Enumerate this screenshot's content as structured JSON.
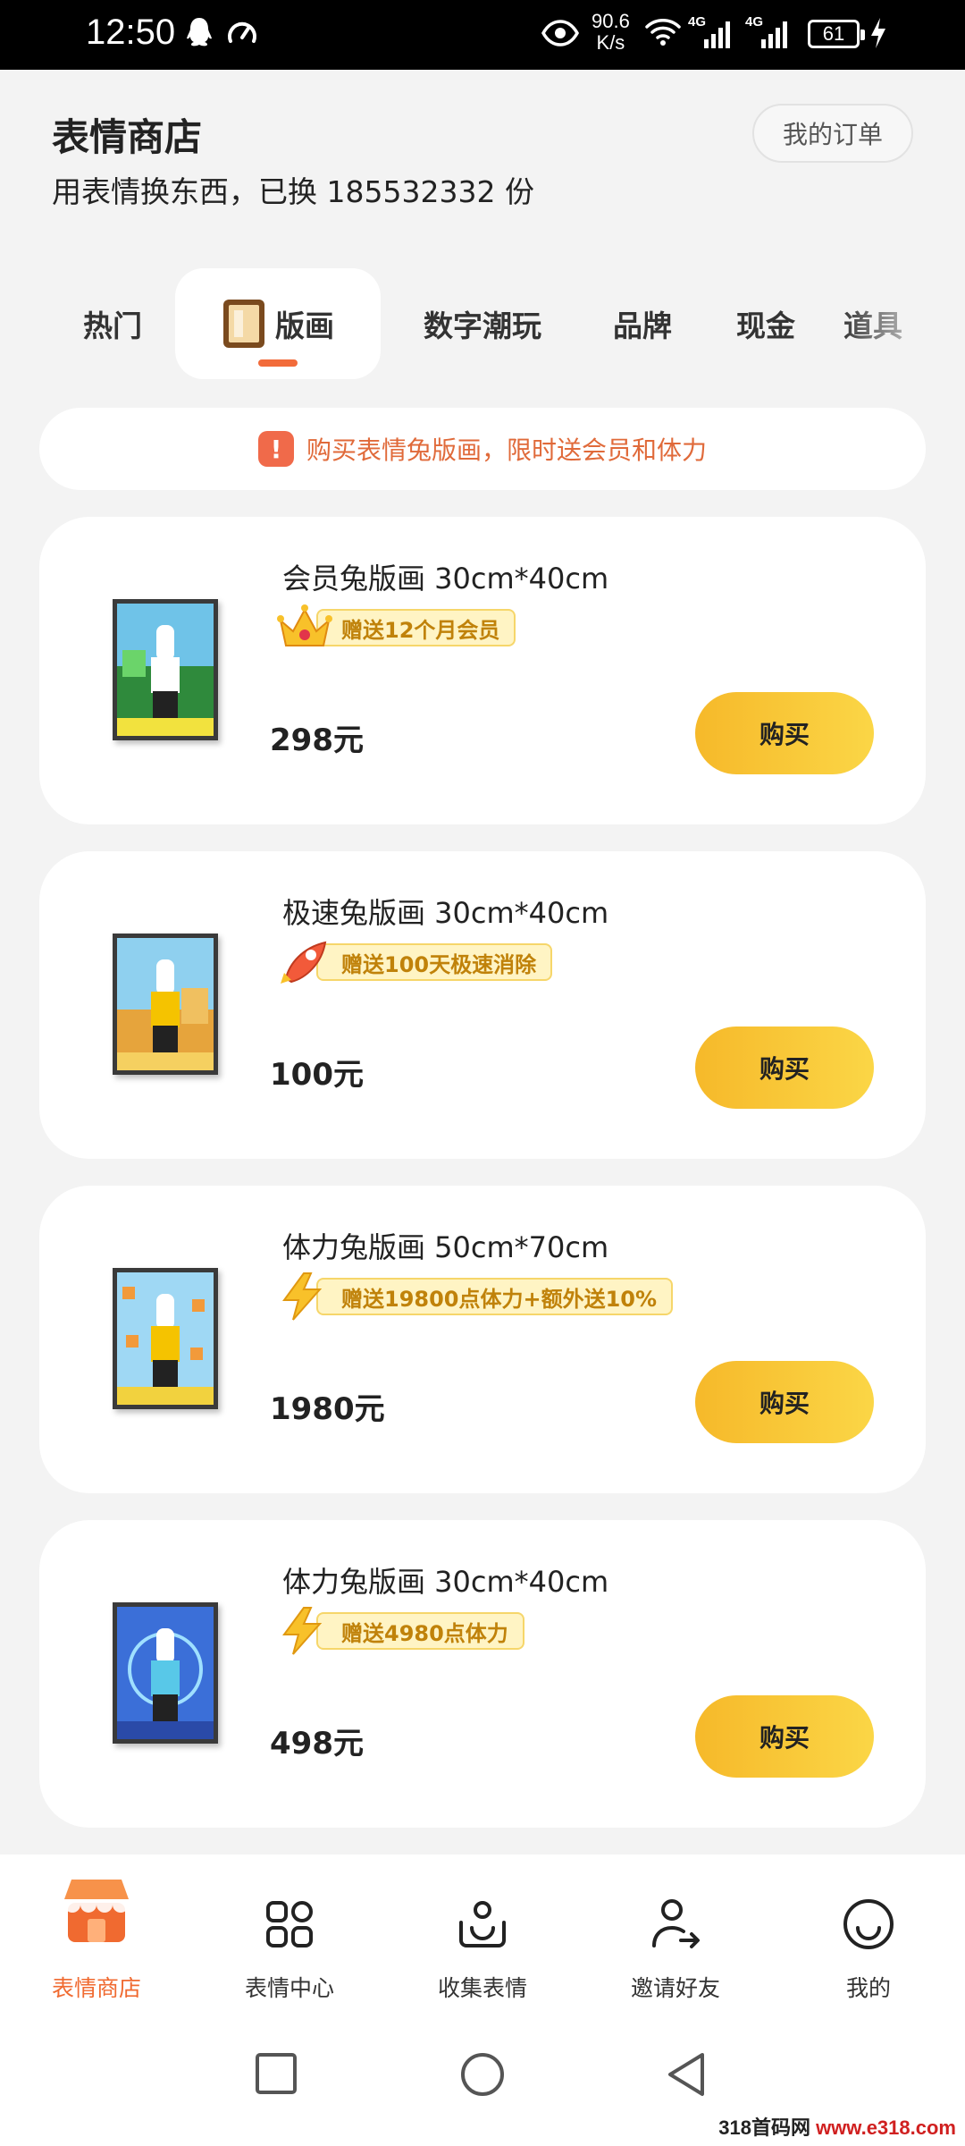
{
  "status_bar": {
    "time": "12:50",
    "net_speed_value": "90.6",
    "net_speed_unit": "K/s",
    "network_label_1": "4G",
    "network_label_2": "4G",
    "battery": "61"
  },
  "header": {
    "title": "表情商店",
    "subtitle": "用表情换东西，已换 185532332 份",
    "orders_button": "我的订单"
  },
  "tabs": [
    {
      "label": "热门"
    },
    {
      "label": "版画",
      "active": true
    },
    {
      "label": "数字潮玩"
    },
    {
      "label": "品牌"
    },
    {
      "label": "现金"
    },
    {
      "label": "道具"
    }
  ],
  "notice": {
    "icon": "!",
    "text": "购买表情兔版画，限时送会员和体力"
  },
  "products": [
    {
      "name": "会员兔版画 30cm*40cm",
      "gift_icon": "crown-icon",
      "gift": "赠送12个月会员",
      "price": "298元",
      "buy": "购买"
    },
    {
      "name": "极速兔版画 30cm*40cm",
      "gift_icon": "rocket-icon",
      "gift": "赠送100天极速消除",
      "price": "100元",
      "buy": "购买"
    },
    {
      "name": "体力兔版画 50cm*70cm",
      "gift_icon": "lightning-icon",
      "gift": "赠送19800点体力+额外送10%",
      "price": "1980元",
      "buy": "购买"
    },
    {
      "name": "体力兔版画 30cm*40cm",
      "gift_icon": "lightning-icon",
      "gift": "赠送4980点体力",
      "price": "498元",
      "buy": "购买"
    }
  ],
  "bottom_nav": [
    {
      "label": "表情商店",
      "icon": "shop-icon",
      "active": true
    },
    {
      "label": "表情中心",
      "icon": "grid-icon"
    },
    {
      "label": "收集表情",
      "icon": "collect-icon"
    },
    {
      "label": "邀请好友",
      "icon": "invite-icon"
    },
    {
      "label": "我的",
      "icon": "smile-icon"
    }
  ],
  "watermark": {
    "part1": "318首码网",
    "part2": " www.e318.com"
  },
  "colors": {
    "accent": "#f06a30",
    "buy_button": "#f8c53a",
    "gift_text": "#c0820a"
  }
}
